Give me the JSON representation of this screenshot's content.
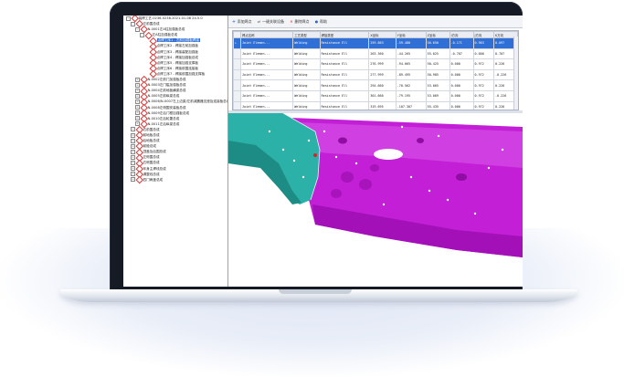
{
  "app": {
    "tree": {
      "items": [
        {
          "label": "装焊工艺-0236-0238-2021-01-08 24.5.0",
          "level": 0,
          "expander": "-",
          "selected": false
        },
        {
          "label": "左前围总成",
          "level": 1,
          "expander": "-",
          "selected": false
        },
        {
          "label": "N-0001左A柱加强板总成",
          "level": 2,
          "expander": "-",
          "selected": false
        },
        {
          "label": "左A柱加强板总成",
          "level": 3,
          "expander": "-",
          "selected": false
        },
        {
          "label": "点焊工序1 - 左前加强板焊接",
          "level": 4,
          "expander": "",
          "selected": true
        },
        {
          "label": "点焊工序2 - 焊接左前加强板",
          "level": 4,
          "expander": "",
          "selected": false
        },
        {
          "label": "点焊工序3 - 焊接装配加强板",
          "level": 4,
          "expander": "",
          "selected": false
        },
        {
          "label": "点焊工序4 - 焊接加强板总成",
          "level": 4,
          "expander": "",
          "selected": false
        },
        {
          "label": "点焊工序5 - 焊接加强支撑板",
          "level": 4,
          "expander": "",
          "selected": false
        },
        {
          "label": "点焊工序6 - 焊接前围连接板",
          "level": 4,
          "expander": "",
          "selected": false
        },
        {
          "label": "点焊工序7 - 焊接前围加强支撑板",
          "level": 4,
          "expander": "",
          "selected": false
        },
        {
          "label": "N-0002左前门加强板总成",
          "level": 2,
          "expander": "+",
          "selected": false
        },
        {
          "label": "N-0003左门槛加强板总成",
          "level": 2,
          "expander": "+",
          "selected": false
        },
        {
          "label": "N-0004左前地板横梁总成",
          "level": 2,
          "expander": "+",
          "selected": false
        },
        {
          "label": "N-0005左前纵梁总成",
          "level": 2,
          "expander": "+",
          "selected": false
        },
        {
          "label": "N-0006/N-0007左上边梁/左前减震器支座及连接板总成",
          "level": 2,
          "expander": "+",
          "selected": false
        },
        {
          "label": "N-0008左侧围安装板总成",
          "level": 2,
          "expander": "+",
          "selected": false
        },
        {
          "label": "N-0009左后门框加强板总成",
          "level": 2,
          "expander": "+",
          "selected": false
        },
        {
          "label": "N-0010左后轮罩总成",
          "level": 2,
          "expander": "+",
          "selected": false
        },
        {
          "label": "N-0011左后纵梁总成",
          "level": 2,
          "expander": "+",
          "selected": false
        },
        {
          "label": "右前围总成",
          "level": 1,
          "expander": "+",
          "selected": false
        },
        {
          "label": "前地板总成",
          "level": 1,
          "expander": "+",
          "selected": false
        },
        {
          "label": "后地板总成",
          "level": 1,
          "expander": "+",
          "selected": false
        },
        {
          "label": "前舱总成",
          "level": 1,
          "expander": "+",
          "selected": false
        },
        {
          "label": "顶盖及后围总成",
          "level": 1,
          "expander": "+",
          "selected": false
        },
        {
          "label": "左侧围总成",
          "level": 1,
          "expander": "+",
          "selected": false
        },
        {
          "label": "右侧围总成",
          "level": 1,
          "expander": "+",
          "selected": false
        },
        {
          "label": "车身主焊线总成",
          "level": 1,
          "expander": "+",
          "selected": false
        },
        {
          "label": "调整线总成",
          "level": 1,
          "expander": "+",
          "selected": false
        },
        {
          "label": "四门两盖总成",
          "level": 1,
          "expander": "+",
          "selected": false
        }
      ]
    },
    "toolbar": {
      "add_label": "添加焊点",
      "link_label": "一键关联设备",
      "delete_label": "删除焊点",
      "info_label": "帮助"
    },
    "table": {
      "columns": [
        "焊点名称",
        "工艺类型",
        "焊接类型",
        "X坐标",
        "Y坐标",
        "Z坐标",
        "I方向",
        "J方向",
        "K方向"
      ],
      "rows": [
        [
          "Joint Elemen...",
          "Welding",
          "Resistance Ell",
          "259.863",
          "-59.480",
          "56.650",
          "-0.171",
          "0.963",
          "0.097"
        ],
        [
          "Joint Elemen...",
          "Welding",
          "Resistance Ell",
          "263.360",
          "-44.265",
          "55.025",
          "-0.707",
          "0.000",
          "0.707"
        ],
        [
          "Joint Elemen...",
          "Welding",
          "Resistance Ell",
          "276.999",
          "-94.065",
          "50.425",
          "0.000",
          "0.972",
          "0.226"
        ],
        [
          "Joint Elemen...",
          "Welding",
          "Resistance Ell",
          "277.999",
          "-89.495",
          "50.985",
          "0.000",
          "0.972",
          "-0.226"
        ],
        [
          "Joint Elemen...",
          "Welding",
          "Resistance Ell",
          "294.660",
          "-70.562",
          "53.065",
          "0.000",
          "0.972",
          "0.226"
        ],
        [
          "Joint Elemen...",
          "Welding",
          "Resistance Ell",
          "301.660",
          "-79.195",
          "53.069",
          "0.000",
          "0.972",
          "-0.226"
        ],
        [
          "Joint Elemen...",
          "Welding",
          "Resistance Ell",
          "319.695",
          "-107.307",
          "55.435",
          "0.000",
          "0.972",
          "0.226"
        ]
      ],
      "selected_row": 0
    },
    "colors": {
      "part_magenta": "#c21fd6",
      "part_teal": "#2bb1a8",
      "selection": "#2f6fd6",
      "weld_point": "#ffffff"
    }
  }
}
